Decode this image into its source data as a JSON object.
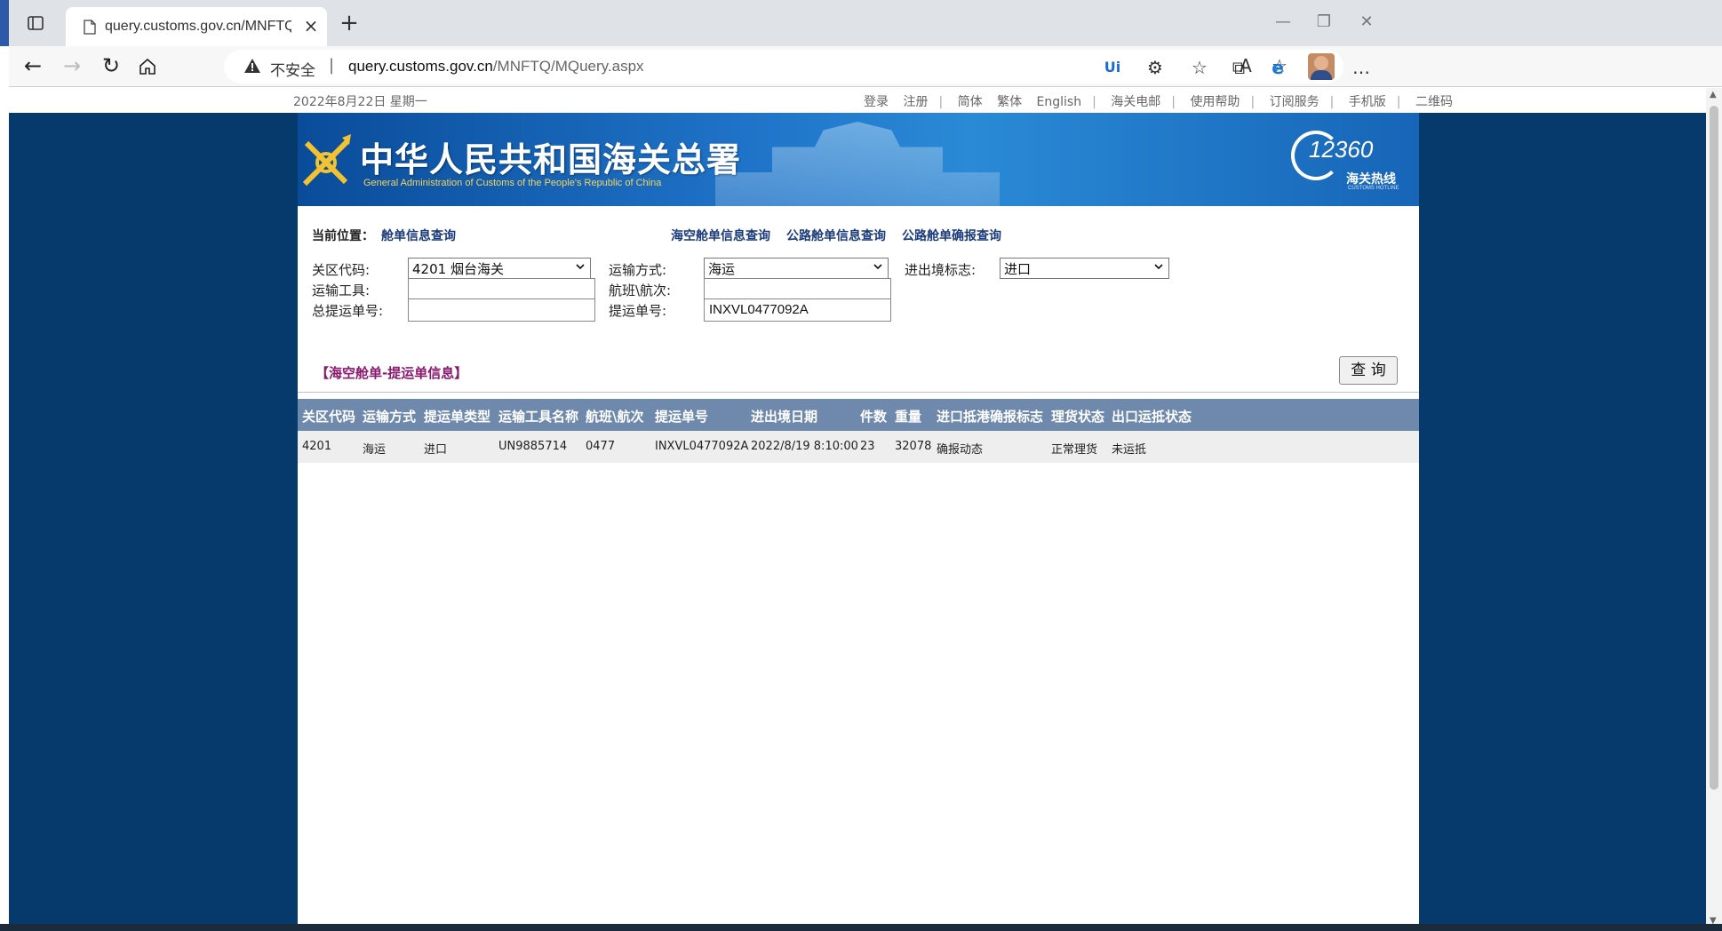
{
  "browser": {
    "tab_title": "query.customs.gov.cn/MNFTQ/M",
    "security_label": "不安全",
    "url_host": "query.customs.gov.cn",
    "url_path": "/MNFTQ/MQuery.aspx"
  },
  "top_strip": {
    "date": "2022年8月22日 星期一",
    "links": [
      "登录",
      "注册",
      "简体",
      "繁体",
      "English",
      "海关电邮",
      "使用帮助",
      "订阅服务",
      "手机版",
      "二维码"
    ]
  },
  "banner": {
    "title_cn": "中华人民共和国海关总署",
    "title_en": "General Administration of Customs of the People's Republic of China",
    "hotline_number": "12360",
    "hotline_label": "海关热线",
    "hotline_sub": "CUSTOMS HOTLINE"
  },
  "breadcrumb": {
    "label": "当前位置：",
    "value": "舱单信息查询"
  },
  "sublinks": [
    "海空舱单信息查询",
    "公路舱单信息查询",
    "公路舱单确报查询"
  ],
  "form": {
    "customs_code_label": "关区代码:",
    "customs_code_value": "4201 烟台海关",
    "transport_mode_label": "运输方式:",
    "transport_mode_value": "海运",
    "io_flag_label": "进出境标志:",
    "io_flag_value": "进口",
    "vehicle_label": "运输工具:",
    "vehicle_value": "",
    "voyage_label": "航班\\航次:",
    "voyage_value": "",
    "master_bill_label": "总提运单号:",
    "master_bill_value": "",
    "bill_label": "提运单号:",
    "bill_value": "INXVL0477092A",
    "query_button": "查 询"
  },
  "section_title": "【海空舱单-提运单信息】",
  "table": {
    "headers": [
      "关区代码",
      "运输方式",
      "提运单类型",
      "运输工具名称",
      "航班\\航次",
      "提运单号",
      "进出境日期",
      "件数",
      "重量",
      "进口抵港确报标志",
      "理货状态",
      "出口运抵状态"
    ],
    "rows": [
      [
        "4201",
        "海运",
        "进口",
        "UN9885714",
        "0477",
        "INXVL0477092A",
        "2022/8/19 8:10:00",
        "23",
        "32078",
        "确报动态",
        "正常理货",
        "未运抵"
      ]
    ]
  }
}
